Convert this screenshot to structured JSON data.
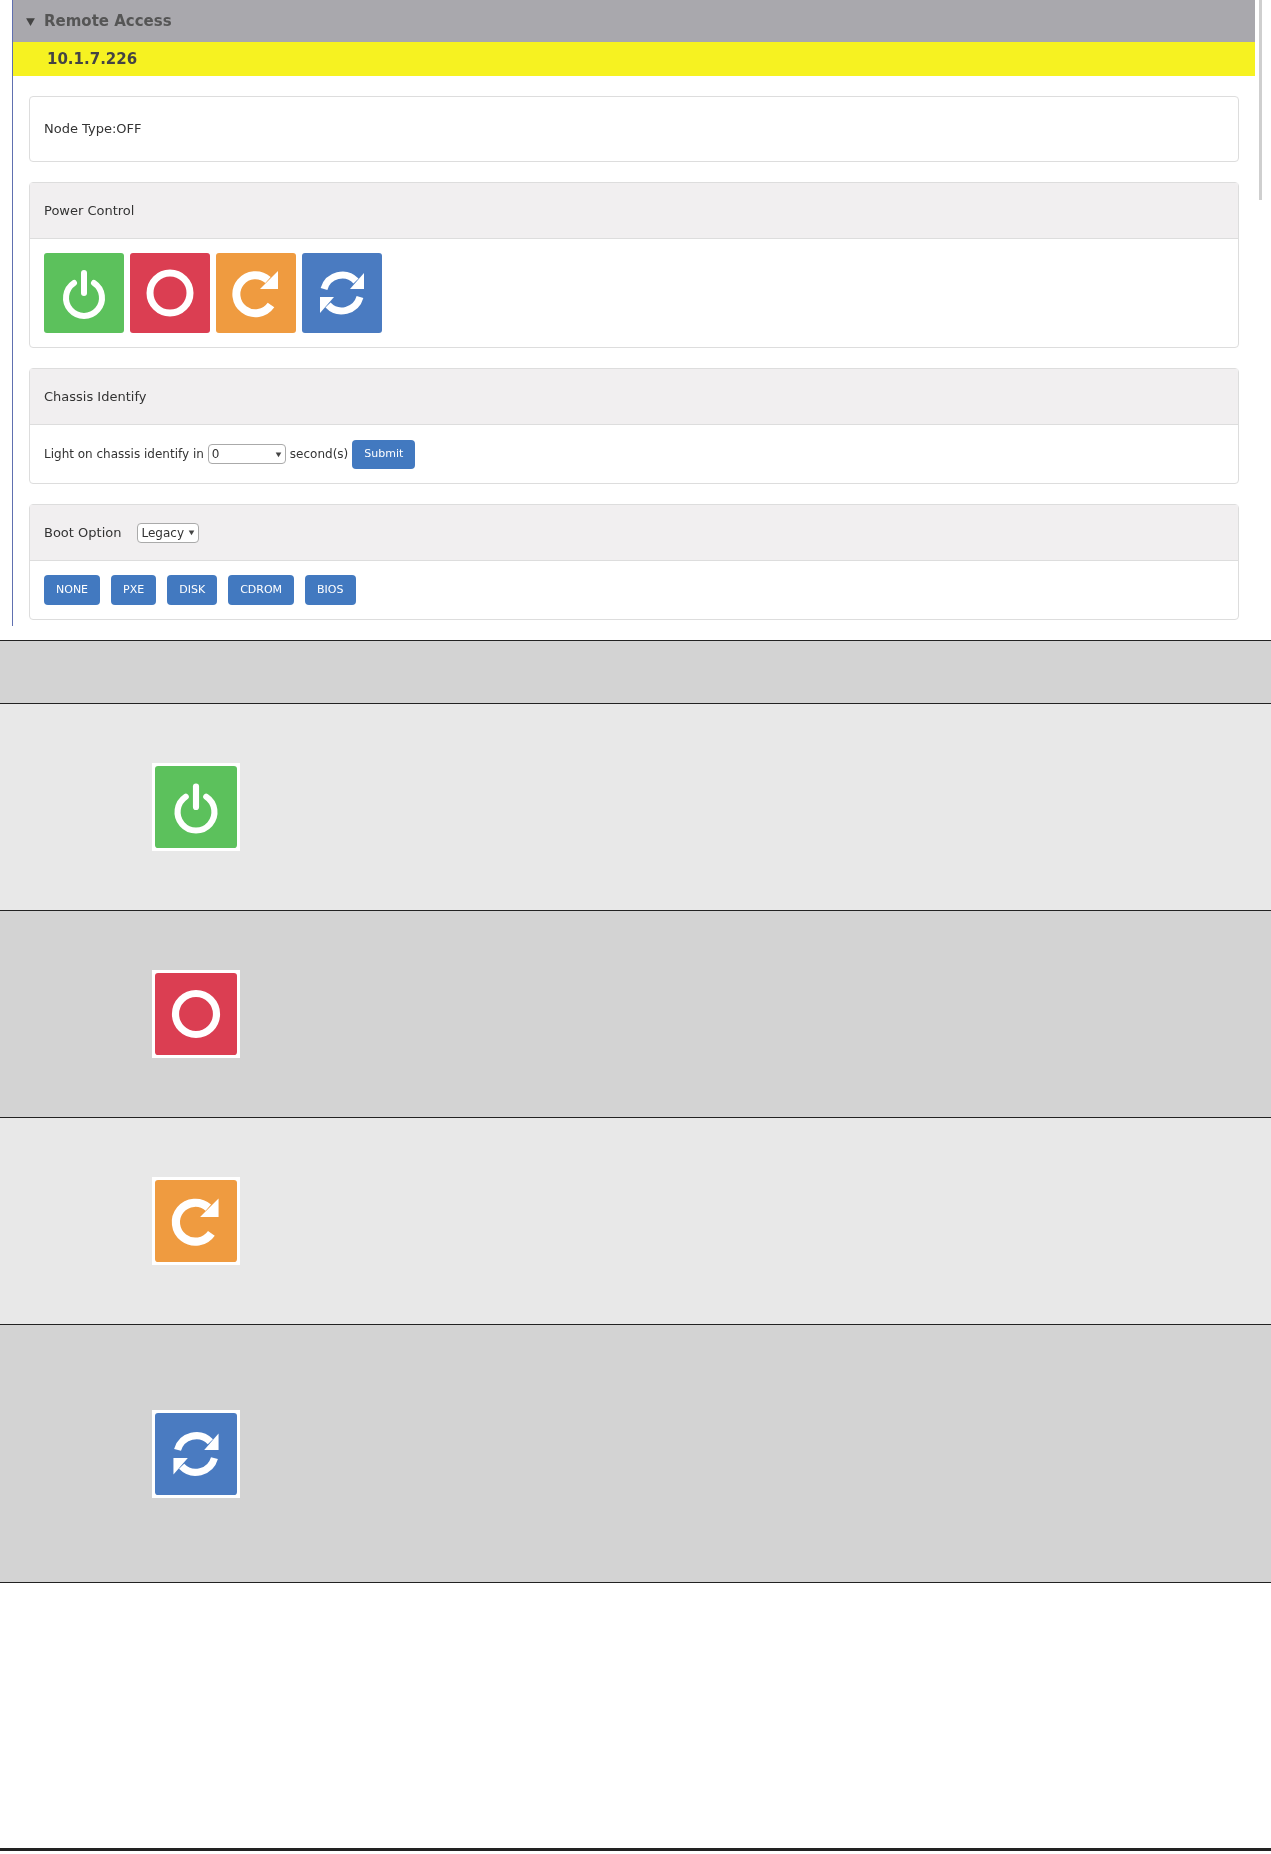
{
  "panel": {
    "title": "Remote Access",
    "expanded": true,
    "address": "10.1.7.226"
  },
  "node_type": "Node Type:OFF",
  "power_control": {
    "title": "Power Control",
    "buttons": [
      {
        "kind": "power"
      },
      {
        "kind": "stop"
      },
      {
        "kind": "restart"
      },
      {
        "kind": "cycle"
      }
    ]
  },
  "chassis_identify": {
    "title": "Chassis Identify",
    "label": "Light on chassis identify in",
    "value": "0",
    "unit": "second(s)",
    "button": "Submit"
  },
  "boot_option": {
    "title": "Boot Option",
    "mode": "Legacy",
    "buttons": [
      "NONE",
      "PXE",
      "DISK",
      "CDROM",
      "BIOS"
    ]
  },
  "icon_table": {
    "rows": [
      {
        "kind": "power"
      },
      {
        "kind": "stop"
      },
      {
        "kind": "restart"
      },
      {
        "kind": "cycle"
      }
    ]
  }
}
